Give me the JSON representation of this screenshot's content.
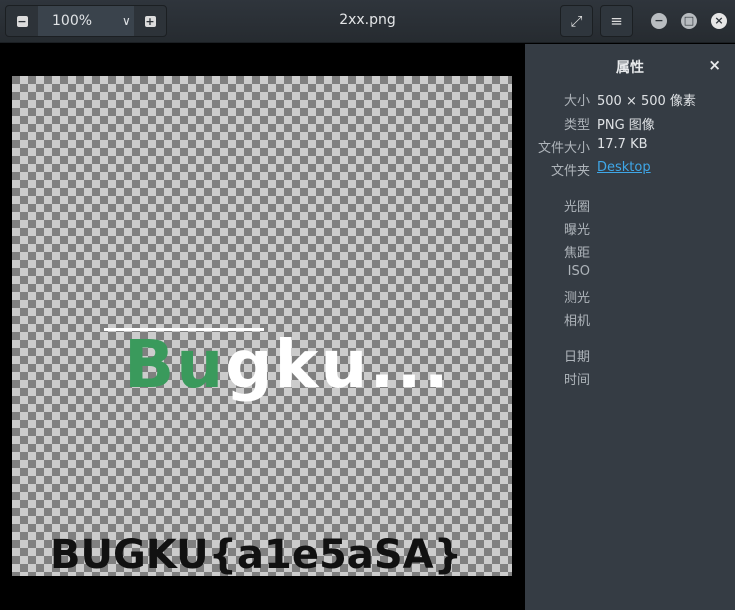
{
  "header": {
    "zoom": "100%",
    "title": "2xx.png"
  },
  "image": {
    "logo_text_green": "Bu",
    "logo_text_white": "gku...",
    "flag_text": "BUGKU{a1e5aSA}"
  },
  "sidebar": {
    "title": "属性",
    "rows": [
      {
        "label": "大小",
        "value": "500 × 500 像素"
      },
      {
        "label": "类型",
        "value": "PNG 图像"
      },
      {
        "label": "文件大小",
        "value": "17.7 KB"
      },
      {
        "label": "文件夹",
        "value": "Desktop"
      },
      {
        "label": "光圈",
        "value": ""
      },
      {
        "label": "曝光",
        "value": ""
      },
      {
        "label": "焦距",
        "value": ""
      },
      {
        "label": "ISO",
        "value": ""
      },
      {
        "label": "测光",
        "value": ""
      },
      {
        "label": "相机",
        "value": ""
      },
      {
        "label": "日期",
        "value": ""
      },
      {
        "label": "时间",
        "value": ""
      }
    ]
  },
  "colors": {
    "logo_green": "#3a9a5c",
    "link": "#3fa7e8"
  }
}
